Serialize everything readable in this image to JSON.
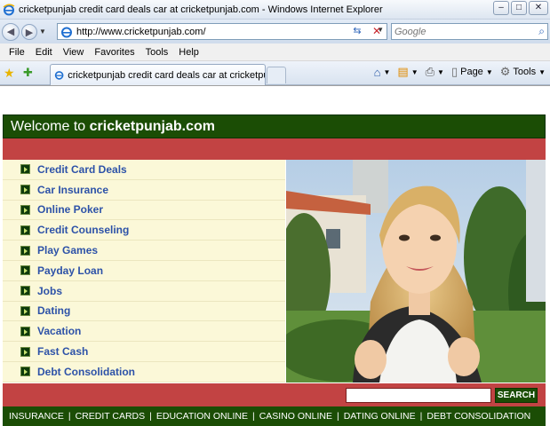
{
  "window": {
    "title": "cricketpunjab credit card deals car at cricketpunjab.com - Windows Internet Explorer",
    "minimize_label": "–",
    "maximize_label": "□",
    "close_label": "✕"
  },
  "address_bar": {
    "url": "http://www.cricketpunjab.com/",
    "search_placeholder": "Google"
  },
  "menu_bar": {
    "items": [
      "File",
      "Edit",
      "View",
      "Favorites",
      "Tools",
      "Help"
    ]
  },
  "tab_bar": {
    "tab_label": "cricketpunjab credit card deals car at cricketpunjab...",
    "page_label": "Page",
    "tools_label": "Tools"
  },
  "page": {
    "welcome_prefix": "Welcome to ",
    "welcome_site": "cricketpunjab.com",
    "menu_items": [
      "Credit Card Deals",
      "Car Insurance",
      "Online Poker",
      "Credit Counseling",
      "Play Games",
      "Payday Loan",
      "Jobs",
      "Dating",
      "Vacation",
      "Fast Cash",
      "Debt Consolidation"
    ],
    "search_button": "SEARCH",
    "footer_links": [
      "INSURANCE",
      "CREDIT CARDS",
      "EDUCATION ONLINE",
      "CASINO ONLINE",
      "DATING ONLINE",
      "DEBT CONSOLIDATION"
    ]
  },
  "colors": {
    "header_green": "#1b4d05",
    "bar_red": "#c24343",
    "menu_bg": "#fbf8d8",
    "link_blue": "#2d52a8"
  }
}
